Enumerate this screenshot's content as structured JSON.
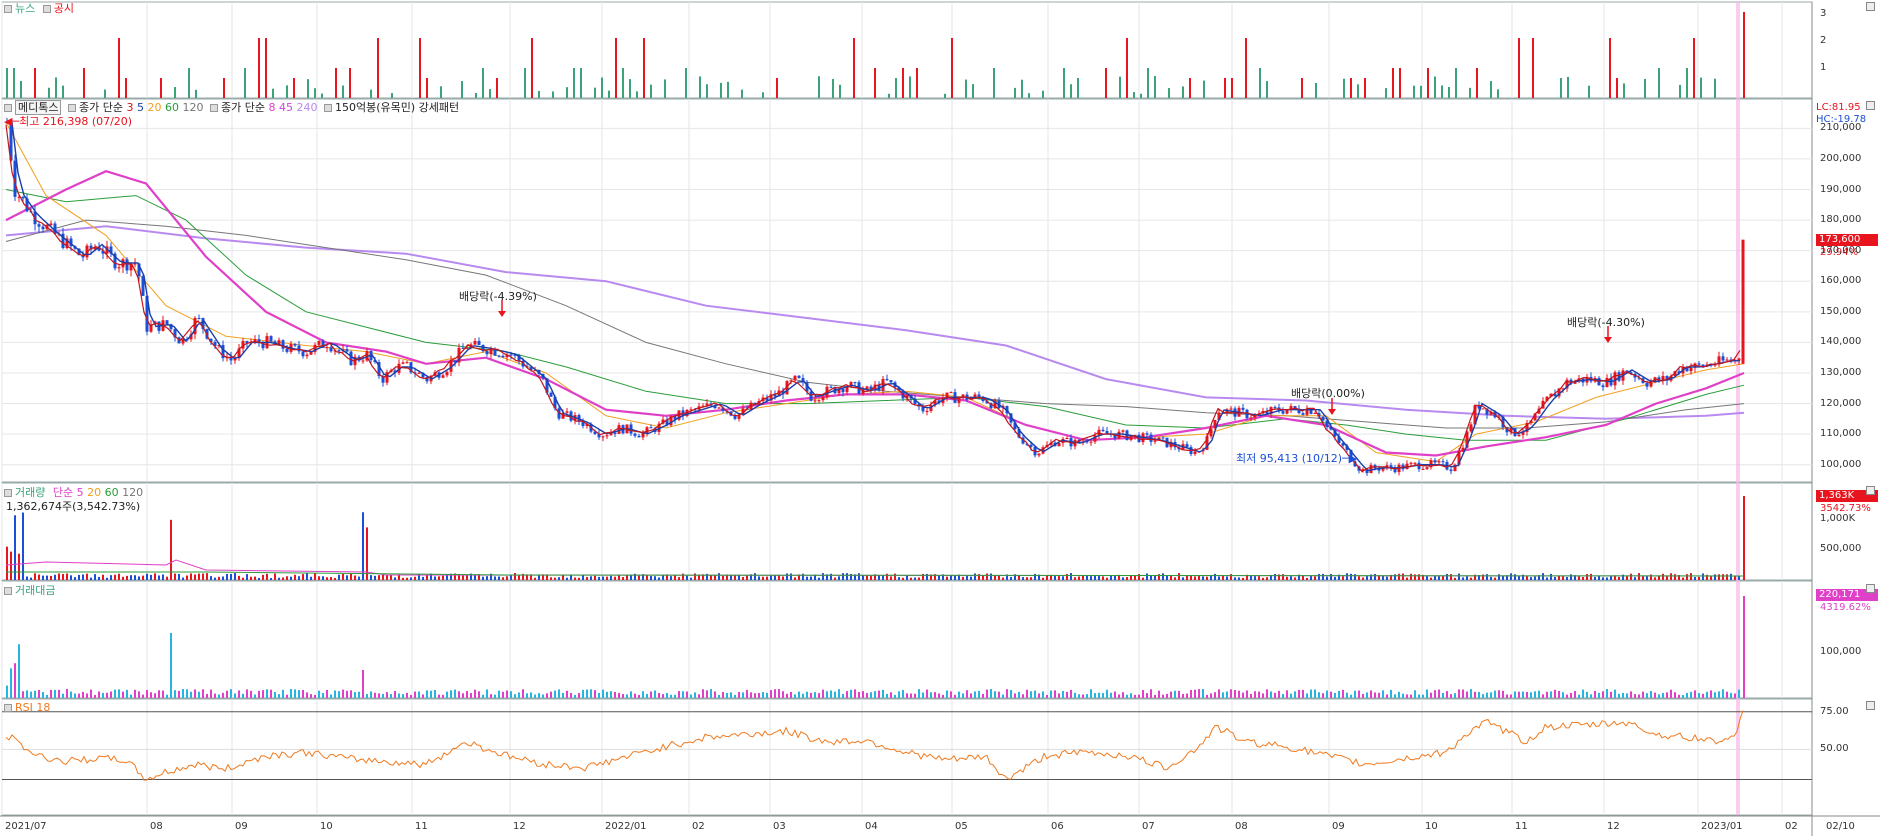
{
  "colors": {
    "up": "#e8141e",
    "down": "#1b4fd8",
    "news": "#3aa37a",
    "disclosure": "#e8141e",
    "ma3": "#c4161c",
    "ma5": "#1b3fa8",
    "ma20": "#f0a020",
    "ma60": "#2a9d3a",
    "ma120": "#777777",
    "ma8": "#e03fc8",
    "ma45": "#cc44dd",
    "ma240": "#b88af0",
    "rsi": "#f07a1e",
    "vol_up": "#e8141e",
    "vol_down": "#1b4fd8",
    "amt": "#e03fc8",
    "amt2": "#28b4e0"
  },
  "news_panel": {
    "news_label": "뉴스",
    "disc_label": "공시",
    "yticks": [
      "3",
      "2",
      "1"
    ]
  },
  "price_panel": {
    "stock_name": "메디톡스",
    "ma_group1_label": "종가 단순",
    "ma_group1_periods": [
      "3",
      "5",
      "20",
      "60",
      "120"
    ],
    "ma_group2_label": "종가 단순",
    "ma_group2_periods": [
      "8",
      "45",
      "240"
    ],
    "pattern_label": "150억봉(유목민) 강세패턴",
    "high_label": "최고 216,398 (07/20)",
    "low_label": "최저 95,413 (10/12)",
    "lc_label": "LC:81.95",
    "hc_label": "HC:-19.78",
    "last_price": "173,600",
    "last_change": "29.94%",
    "annotations": [
      "배당락(-4.39%)",
      "배당락(0.00%)",
      "배당락(-4.30%)"
    ],
    "yticks": [
      "210,000",
      "200,000",
      "190,000",
      "180,000",
      "170,000",
      "160,000",
      "150,000",
      "140,000",
      "130,000",
      "120,000",
      "110,000",
      "100,000"
    ]
  },
  "volume_panel": {
    "label": "거래량",
    "ma_label": "단순",
    "ma_periods": [
      "5",
      "20",
      "60",
      "120"
    ],
    "current": "1,362,674주(3,542.73%)",
    "badge": "1,363K",
    "badge_pct": "3542.73%",
    "yticks": [
      "1,000K",
      "500,000"
    ]
  },
  "amount_panel": {
    "label": "거래대금",
    "badge": "220,171",
    "badge_pct": "4319.62%",
    "yticks": [
      "100,000"
    ]
  },
  "rsi_panel": {
    "label": "RSI 18",
    "yticks": [
      "75.00",
      "50.00"
    ]
  },
  "xaxis": {
    "labels": [
      "2021/07",
      "08",
      "09",
      "10",
      "11",
      "12",
      "2022/01",
      "02",
      "03",
      "04",
      "05",
      "06",
      "07",
      "08",
      "09",
      "10",
      "11",
      "12",
      "2023/01",
      "02"
    ],
    "last_date": "02/10"
  },
  "chart_data": {
    "type": "candlestick",
    "title": "메디톡스",
    "y_range": [
      95000,
      220000
    ],
    "price_path": [
      [
        0,
        212000
      ],
      [
        8,
        190000
      ],
      [
        25,
        182000
      ],
      [
        45,
        176000
      ],
      [
        60,
        172000
      ],
      [
        75,
        168000
      ],
      [
        90,
        172000
      ],
      [
        110,
        166000
      ],
      [
        130,
        166000
      ],
      [
        140,
        145000
      ],
      [
        160,
        146000
      ],
      [
        175,
        140000
      ],
      [
        190,
        148000
      ],
      [
        210,
        138000
      ],
      [
        225,
        134000
      ],
      [
        240,
        140000
      ],
      [
        260,
        140000
      ],
      [
        280,
        138000
      ],
      [
        300,
        137000
      ],
      [
        320,
        140000
      ],
      [
        345,
        134000
      ],
      [
        360,
        136000
      ],
      [
        375,
        128000
      ],
      [
        390,
        132000
      ],
      [
        400,
        132000
      ],
      [
        420,
        128000
      ],
      [
        440,
        132000
      ],
      [
        460,
        139000
      ],
      [
        480,
        138000
      ],
      [
        505,
        136000
      ],
      [
        520,
        132000
      ],
      [
        535,
        128000
      ],
      [
        550,
        117000
      ],
      [
        575,
        114000
      ],
      [
        595,
        110000
      ],
      [
        615,
        112000
      ],
      [
        635,
        110000
      ],
      [
        655,
        113000
      ],
      [
        670,
        116000
      ],
      [
        690,
        118000
      ],
      [
        710,
        120000
      ],
      [
        730,
        116000
      ],
      [
        750,
        120000
      ],
      [
        770,
        123000
      ],
      [
        790,
        128000
      ],
      [
        805,
        122000
      ],
      [
        820,
        124000
      ],
      [
        840,
        126000
      ],
      [
        860,
        124000
      ],
      [
        880,
        127000
      ],
      [
        900,
        122000
      ],
      [
        915,
        118000
      ],
      [
        935,
        122000
      ],
      [
        955,
        122000
      ],
      [
        975,
        122000
      ],
      [
        995,
        118000
      ],
      [
        1010,
        110000
      ],
      [
        1030,
        104000
      ],
      [
        1050,
        108000
      ],
      [
        1070,
        107000
      ],
      [
        1090,
        110000
      ],
      [
        1110,
        110000
      ],
      [
        1130,
        109000
      ],
      [
        1150,
        108000
      ],
      [
        1170,
        106000
      ],
      [
        1190,
        104000
      ],
      [
        1200,
        108000
      ],
      [
        1210,
        118000
      ],
      [
        1230,
        117000
      ],
      [
        1250,
        116000
      ],
      [
        1270,
        118000
      ],
      [
        1290,
        118000
      ],
      [
        1310,
        118000
      ],
      [
        1320,
        112000
      ],
      [
        1340,
        104000
      ],
      [
        1355,
        98000
      ],
      [
        1370,
        99000
      ],
      [
        1390,
        99000
      ],
      [
        1410,
        100000
      ],
      [
        1430,
        100000
      ],
      [
        1445,
        99000
      ],
      [
        1460,
        110000
      ],
      [
        1470,
        120000
      ],
      [
        1490,
        116000
      ],
      [
        1505,
        110000
      ],
      [
        1520,
        112000
      ],
      [
        1540,
        121000
      ],
      [
        1560,
        127000
      ],
      [
        1580,
        128000
      ],
      [
        1600,
        127000
      ],
      [
        1620,
        131000
      ],
      [
        1640,
        127000
      ],
      [
        1660,
        128000
      ],
      [
        1675,
        132000
      ],
      [
        1690,
        132000
      ],
      [
        1705,
        133000
      ],
      [
        1720,
        134000
      ],
      [
        1730,
        134000
      ],
      [
        1735,
        138000
      ],
      [
        1738,
        173600
      ]
    ],
    "ma20_path": [
      [
        0,
        212000
      ],
      [
        40,
        188000
      ],
      [
        100,
        175000
      ],
      [
        160,
        152000
      ],
      [
        220,
        142000
      ],
      [
        300,
        139000
      ],
      [
        360,
        137000
      ],
      [
        420,
        133000
      ],
      [
        480,
        137000
      ],
      [
        540,
        130000
      ],
      [
        600,
        116000
      ],
      [
        660,
        112000
      ],
      [
        720,
        117000
      ],
      [
        780,
        120000
      ],
      [
        840,
        123000
      ],
      [
        900,
        124000
      ],
      [
        960,
        122000
      ],
      [
        1020,
        113000
      ],
      [
        1080,
        108000
      ],
      [
        1140,
        109000
      ],
      [
        1200,
        110000
      ],
      [
        1260,
        116000
      ],
      [
        1320,
        116000
      ],
      [
        1370,
        104000
      ],
      [
        1430,
        101000
      ],
      [
        1470,
        110000
      ],
      [
        1530,
        114000
      ],
      [
        1590,
        122000
      ],
      [
        1650,
        127000
      ],
      [
        1700,
        131000
      ],
      [
        1738,
        133000
      ]
    ],
    "ma60_path": [
      [
        0,
        190000
      ],
      [
        60,
        186000
      ],
      [
        130,
        188000
      ],
      [
        180,
        180000
      ],
      [
        240,
        162000
      ],
      [
        300,
        150000
      ],
      [
        360,
        145000
      ],
      [
        420,
        140000
      ],
      [
        500,
        137000
      ],
      [
        560,
        132000
      ],
      [
        640,
        124000
      ],
      [
        720,
        120000
      ],
      [
        800,
        120000
      ],
      [
        880,
        121000
      ],
      [
        960,
        122000
      ],
      [
        1040,
        119000
      ],
      [
        1120,
        113000
      ],
      [
        1200,
        112000
      ],
      [
        1280,
        115000
      ],
      [
        1340,
        113000
      ],
      [
        1400,
        110000
      ],
      [
        1460,
        108000
      ],
      [
        1540,
        108000
      ],
      [
        1620,
        115000
      ],
      [
        1700,
        123000
      ],
      [
        1738,
        126000
      ]
    ],
    "ma120_path": [
      [
        0,
        173000
      ],
      [
        80,
        180000
      ],
      [
        160,
        178000
      ],
      [
        240,
        175000
      ],
      [
        320,
        171000
      ],
      [
        400,
        167000
      ],
      [
        480,
        162000
      ],
      [
        560,
        152000
      ],
      [
        640,
        140000
      ],
      [
        720,
        133000
      ],
      [
        800,
        127000
      ],
      [
        880,
        124000
      ],
      [
        960,
        122000
      ],
      [
        1040,
        120000
      ],
      [
        1120,
        119000
      ],
      [
        1200,
        117000
      ],
      [
        1280,
        116000
      ],
      [
        1360,
        114000
      ],
      [
        1440,
        112000
      ],
      [
        1520,
        112000
      ],
      [
        1600,
        114000
      ],
      [
        1680,
        118000
      ],
      [
        1738,
        120000
      ]
    ],
    "ma8_path": [
      [
        0,
        180000
      ],
      [
        60,
        190000
      ],
      [
        100,
        196000
      ],
      [
        140,
        192000
      ],
      [
        200,
        168000
      ],
      [
        260,
        150000
      ],
      [
        320,
        140000
      ],
      [
        380,
        137000
      ],
      [
        420,
        133000
      ],
      [
        480,
        135000
      ],
      [
        540,
        128000
      ],
      [
        600,
        118000
      ],
      [
        660,
        116000
      ],
      [
        720,
        118000
      ],
      [
        780,
        121000
      ],
      [
        840,
        123000
      ],
      [
        900,
        123000
      ],
      [
        960,
        121000
      ],
      [
        1020,
        113000
      ],
      [
        1080,
        108000
      ],
      [
        1140,
        109000
      ],
      [
        1200,
        112000
      ],
      [
        1260,
        116000
      ],
      [
        1320,
        113000
      ],
      [
        1380,
        104000
      ],
      [
        1430,
        103000
      ],
      [
        1480,
        106000
      ],
      [
        1540,
        109000
      ],
      [
        1600,
        113000
      ],
      [
        1650,
        120000
      ],
      [
        1700,
        125000
      ],
      [
        1738,
        130000
      ]
    ],
    "ma240_path": [
      [
        0,
        175000
      ],
      [
        100,
        178000
      ],
      [
        200,
        174000
      ],
      [
        300,
        171000
      ],
      [
        400,
        169000
      ],
      [
        500,
        163000
      ],
      [
        600,
        160000
      ],
      [
        700,
        152000
      ],
      [
        800,
        148000
      ],
      [
        900,
        144000
      ],
      [
        1000,
        139000
      ],
      [
        1100,
        128000
      ],
      [
        1200,
        122000
      ],
      [
        1300,
        121000
      ],
      [
        1400,
        118000
      ],
      [
        1500,
        116000
      ],
      [
        1600,
        115000
      ],
      [
        1700,
        116000
      ],
      [
        1738,
        117000
      ]
    ],
    "rsi_path": [
      [
        0,
        60
      ],
      [
        30,
        46
      ],
      [
        60,
        42
      ],
      [
        90,
        44
      ],
      [
        120,
        43
      ],
      [
        140,
        30
      ],
      [
        160,
        35
      ],
      [
        190,
        40
      ],
      [
        220,
        37
      ],
      [
        260,
        46
      ],
      [
        300,
        48
      ],
      [
        340,
        44
      ],
      [
        380,
        42
      ],
      [
        420,
        40
      ],
      [
        460,
        55
      ],
      [
        500,
        46
      ],
      [
        540,
        40
      ],
      [
        580,
        38
      ],
      [
        620,
        45
      ],
      [
        660,
        52
      ],
      [
        700,
        58
      ],
      [
        740,
        60
      ],
      [
        780,
        62
      ],
      [
        820,
        55
      ],
      [
        860,
        56
      ],
      [
        900,
        48
      ],
      [
        940,
        43
      ],
      [
        980,
        45
      ],
      [
        1000,
        30
      ],
      [
        1040,
        46
      ],
      [
        1080,
        48
      ],
      [
        1120,
        46
      ],
      [
        1160,
        38
      ],
      [
        1190,
        50
      ],
      [
        1210,
        65
      ],
      [
        1240,
        55
      ],
      [
        1280,
        52
      ],
      [
        1320,
        46
      ],
      [
        1360,
        40
      ],
      [
        1400,
        44
      ],
      [
        1440,
        48
      ],
      [
        1460,
        60
      ],
      [
        1480,
        68
      ],
      [
        1500,
        62
      ],
      [
        1520,
        55
      ],
      [
        1540,
        65
      ],
      [
        1580,
        66
      ],
      [
        1620,
        68
      ],
      [
        1650,
        60
      ],
      [
        1680,
        58
      ],
      [
        1710,
        56
      ],
      [
        1730,
        57
      ],
      [
        1738,
        80
      ]
    ]
  }
}
